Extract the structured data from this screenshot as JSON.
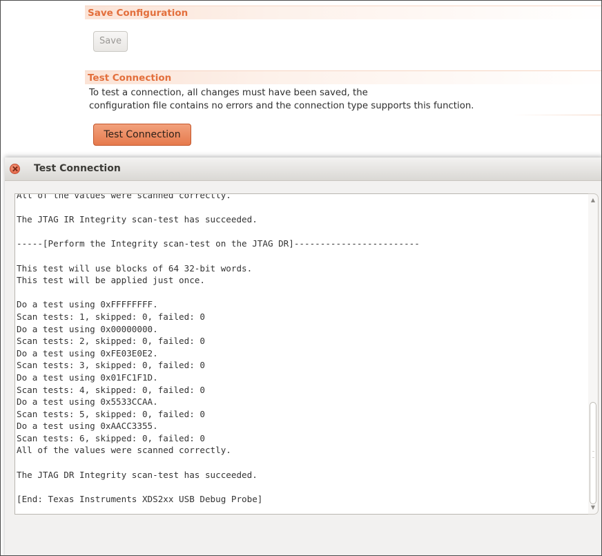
{
  "save_section": {
    "header": "Save Configuration",
    "button_label": "Save",
    "button_enabled": false
  },
  "test_section": {
    "header": "Test Connection",
    "description_line1": "To test a connection, all changes must have been saved, the",
    "description_line2": "configuration file contains no errors and the connection type supports this function.",
    "button_label": "Test Connection"
  },
  "dialog": {
    "title": "Test Connection",
    "close_icon": "close-icon",
    "console_lines": [
      "All of the values were scanned correctly.",
      "",
      "The JTAG IR Integrity scan-test has succeeded.",
      "",
      "-----[Perform the Integrity scan-test on the JTAG DR]------------------------",
      "",
      "This test will use blocks of 64 32-bit words.",
      "This test will be applied just once.",
      "",
      "Do a test using 0xFFFFFFFF.",
      "Scan tests: 1, skipped: 0, failed: 0",
      "Do a test using 0x00000000.",
      "Scan tests: 2, skipped: 0, failed: 0",
      "Do a test using 0xFE03E0E2.",
      "Scan tests: 3, skipped: 0, failed: 0",
      "Do a test using 0x01FC1F1D.",
      "Scan tests: 4, skipped: 0, failed: 0",
      "Do a test using 0x5533CCAA.",
      "Scan tests: 5, skipped: 0, failed: 0",
      "Do a test using 0xAACC3355.",
      "Scan tests: 6, skipped: 0, failed: 0",
      "All of the values were scanned correctly.",
      "",
      "The JTAG DR Integrity scan-test has succeeded.",
      "",
      "[End: Texas Instruments XDS2xx USB Debug Probe]"
    ],
    "scroll_position": 1.0
  },
  "colors": {
    "accent": "#e36f3c",
    "button_primary": "#e67a4d",
    "close_button": "#e0583a"
  }
}
